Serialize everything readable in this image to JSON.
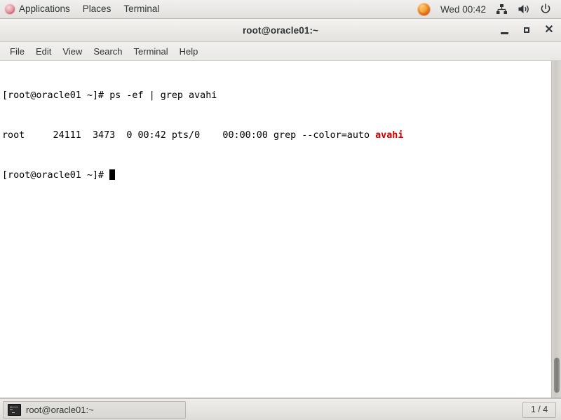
{
  "top_panel": {
    "applications_label": "Applications",
    "places_label": "Places",
    "terminal_label": "Terminal",
    "clock": "Wed 00:42",
    "icons": {
      "menu_icon": "fedora-icon",
      "browser_icon": "firefox-icon",
      "network_icon": "network-icon",
      "volume_icon": "volume-icon",
      "power_icon": "power-icon"
    }
  },
  "window": {
    "title": "root@oracle01:~",
    "controls": {
      "minimize": "_",
      "maximize": "□",
      "close": "✕"
    },
    "menubar": [
      {
        "label": "File"
      },
      {
        "label": "Edit"
      },
      {
        "label": "View"
      },
      {
        "label": "Search"
      },
      {
        "label": "Terminal"
      },
      {
        "label": "Help"
      }
    ]
  },
  "terminal": {
    "lines": [
      {
        "prompt": "[root@oracle01 ~]# ",
        "command": "ps -ef | grep avahi"
      },
      {
        "plain": "root     24111  3473  0 00:42 pts/0    00:00:00 grep --color=auto ",
        "highlight": "avahi"
      },
      {
        "prompt": "[root@oracle01 ~]# ",
        "command": ""
      }
    ],
    "colors": {
      "background": "#ffffff",
      "foreground": "#000000",
      "match_highlight": "#cc0000"
    }
  },
  "bottom_panel": {
    "task_label": "root@oracle01:~",
    "task_icon": "terminal-icon",
    "workspace": "1 / 4"
  }
}
